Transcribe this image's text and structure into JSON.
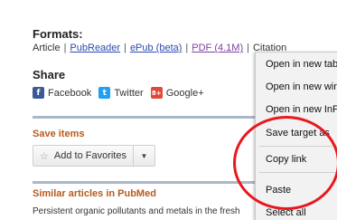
{
  "formats": {
    "title": "Formats:",
    "article": "Article",
    "pubreader": "PubReader",
    "epub": "ePub (beta)",
    "pdf": "PDF (4.1M)",
    "citation": "Citation",
    "separator": "|"
  },
  "share": {
    "title": "Share",
    "facebook": "Facebook",
    "twitter": "Twitter",
    "googleplus": "Google+",
    "fb_glyph": "f",
    "tw_glyph": "t",
    "gp_glyph": "8+"
  },
  "save_items": {
    "title": "Save items",
    "favorites_label": "Add to Favorites",
    "star_glyph": "☆",
    "dropdown_glyph": "▼"
  },
  "similar": {
    "title": "Similar articles in PubMed",
    "first_item": "Persistent organic pollutants and metals in the fresh"
  },
  "context_menu": {
    "items": [
      "Open in new tab",
      "Open in new window",
      "Open in new InPrivate window",
      "Save target as",
      "Copy link",
      "Paste",
      "Select all"
    ]
  },
  "colors": {
    "link": "#2a4bb0",
    "visited_link": "#7b3fa0",
    "section_orange": "#b65a1c",
    "highlight_circle": "#e8181f",
    "divider": "#a9b8c9"
  }
}
